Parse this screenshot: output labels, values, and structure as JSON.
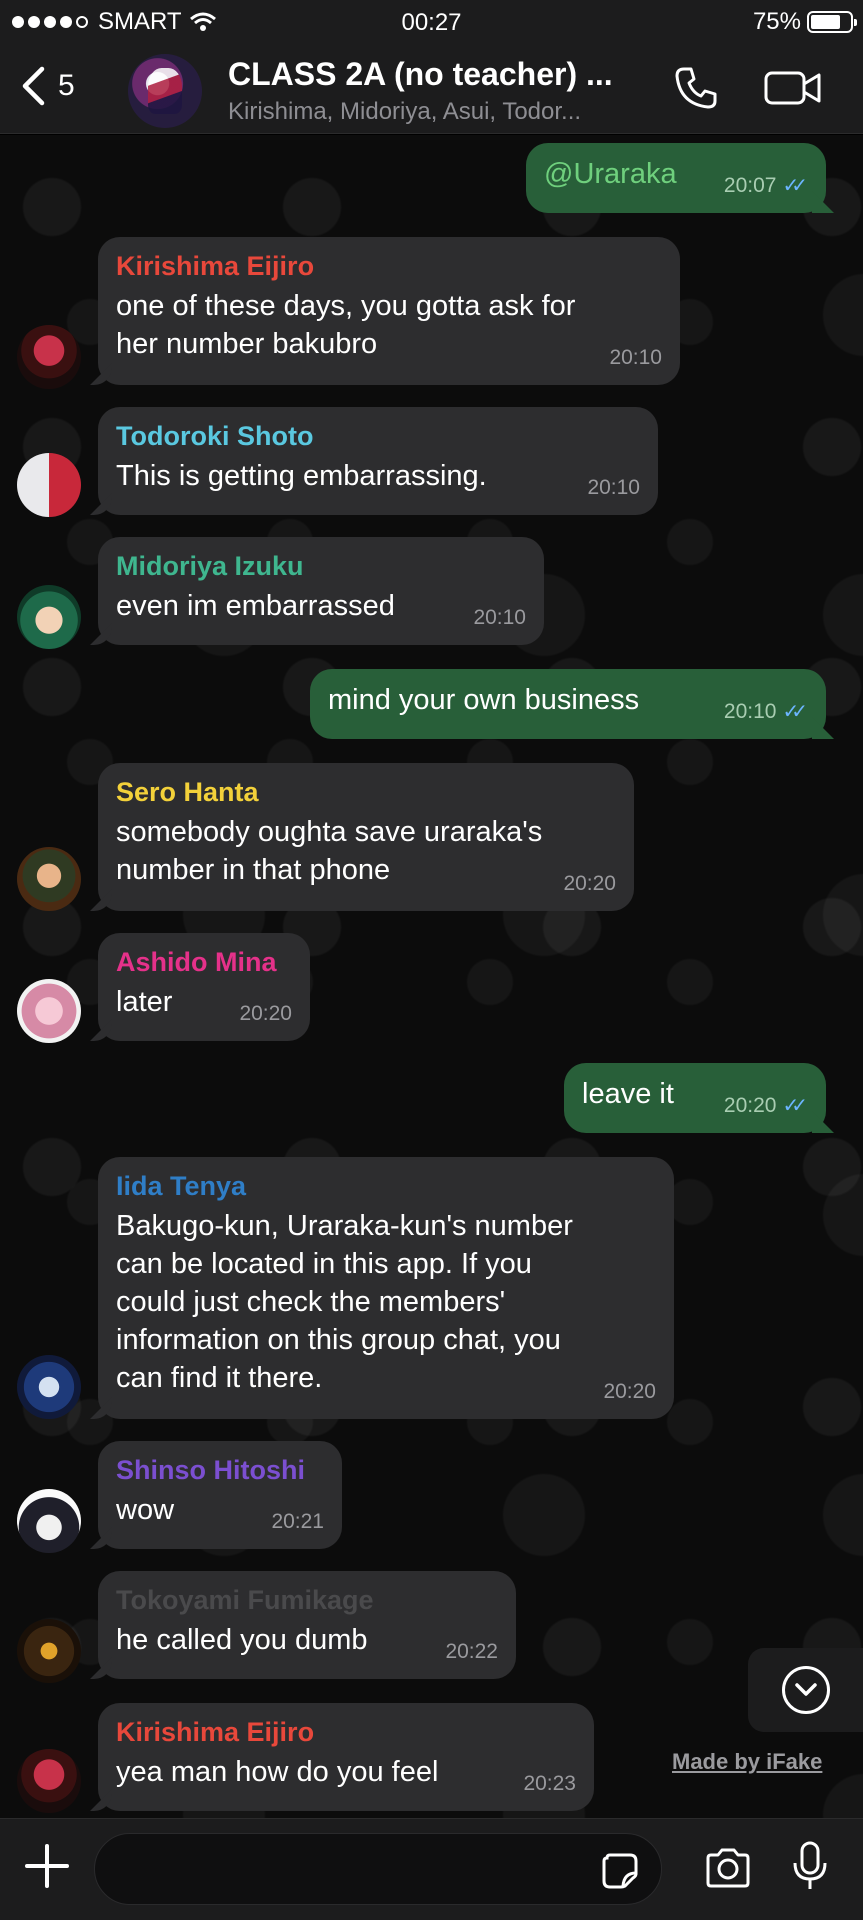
{
  "status_bar": {
    "carrier": "SMART",
    "time": "00:27",
    "battery": "75%",
    "battery_level": 0.75
  },
  "header": {
    "back_count": "5",
    "title": "CLASS 2A (no teacher) ...",
    "subtitle": "Kirishima, Midoriya, Asui, Todor..."
  },
  "messages": [
    {
      "dir": "out",
      "text": "@Uraraka",
      "time": "20:07",
      "read": true
    },
    {
      "dir": "in",
      "sender": "Kirishima Eijiro",
      "color": "#e8483b",
      "text": "one of these days, you gotta ask for\nher number bakubro",
      "time": "20:10",
      "avatar": "kirishima"
    },
    {
      "dir": "in",
      "sender": "Todoroki Shoto",
      "color": "#5ac8e0",
      "text": "This is getting embarrassing.",
      "time": "20:10",
      "avatar": "todoroki"
    },
    {
      "dir": "in",
      "sender": "Midoriya Izuku",
      "color": "#3fb68f",
      "text": "even im embarrassed",
      "time": "20:10",
      "avatar": "midoriya"
    },
    {
      "dir": "out",
      "text": "mind your own business",
      "time": "20:10",
      "read": true
    },
    {
      "dir": "in",
      "sender": "Sero Hanta",
      "color": "#f3d13a",
      "text": "somebody oughta save uraraka's\nnumber in that phone",
      "time": "20:20",
      "avatar": "sero"
    },
    {
      "dir": "in",
      "sender": "Ashido Mina",
      "color": "#e5318a",
      "text": "later",
      "time": "20:20",
      "avatar": "ashido"
    },
    {
      "dir": "out",
      "text": "leave it",
      "time": "20:20",
      "read": true
    },
    {
      "dir": "in",
      "sender": "Iida Tenya",
      "color": "#2f7ec7",
      "text": "Bakugo-kun, Uraraka-kun's number\ncan be located in this app. If you\ncould just check the members'\ninformation on this group chat, you\ncan find it there.",
      "time": "20:20",
      "avatar": "iida"
    },
    {
      "dir": "in",
      "sender": "Shinso Hitoshi",
      "color": "#7b4fd0",
      "text": "wow",
      "time": "20:21",
      "avatar": "shinso"
    },
    {
      "dir": "in",
      "sender": "Tokoyami Fumikage",
      "color": "#4a4a4c",
      "text": "he called you dumb",
      "time": "20:22",
      "avatar": "tokoyami"
    },
    {
      "dir": "in",
      "sender": "Kirishima Eijiro",
      "color": "#e8483b",
      "text": "yea man how do you feel",
      "time": "20:23",
      "avatar": "kirishima"
    }
  ],
  "watermark": "Made by iFake",
  "input": {
    "placeholder": ""
  },
  "icons": {
    "back": "chevron-left-icon",
    "call": "phone-icon",
    "video": "video-camera-icon",
    "scroll": "chevron-down-icon",
    "attach": "plus-icon",
    "sticker": "sticker-icon",
    "camera": "camera-icon",
    "mic": "microphone-icon",
    "read": "double-check-icon"
  }
}
